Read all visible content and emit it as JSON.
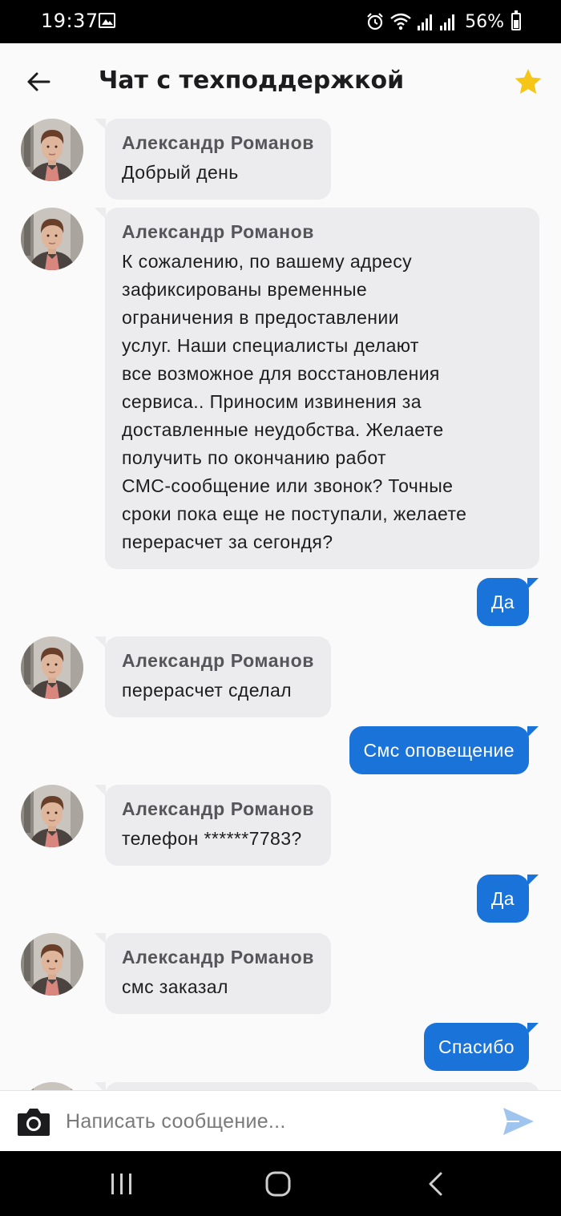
{
  "status_bar": {
    "time": "19:37",
    "battery": "56%",
    "icons": [
      "gallery-icon",
      "alarm-icon",
      "wifi-icon",
      "signal-icon",
      "signal-icon",
      "battery-icon"
    ]
  },
  "header": {
    "title": "Чат с техподдержкой",
    "back_icon": "arrow-left-icon",
    "favorite_icon": "star-icon",
    "favorite_color": "#f5c518"
  },
  "colors": {
    "incoming_bubble": "#ececef",
    "outgoing_bubble": "#1a73d9",
    "send_icon": "#9fc5ef"
  },
  "messages": [
    {
      "direction": "in",
      "sender": "Александр Романов",
      "text": "Добрый день"
    },
    {
      "direction": "in",
      "sender": "Александр Романов",
      "text": "К сожалению, по вашему адресу\nзафиксированы временные\nограничения в предоставлении\nуслуг. Наши специалисты делают\nвсе возможное для восстановления\nсервиса.. Приносим извинения за\nдоставленные неудобства. Желаете\nполучить по окончанию работ\nСМС-сообщение или звонок? Точные\nсроки пока еще не поступали, желаете\nперерасчет за сегондя?"
    },
    {
      "direction": "out",
      "text": "Да"
    },
    {
      "direction": "in",
      "sender": "Александр Романов",
      "text": "перерасчет сделал"
    },
    {
      "direction": "out",
      "text": "Смс оповещение"
    },
    {
      "direction": "in",
      "sender": "Александр Романов",
      "text": "телефон ******7783?"
    },
    {
      "direction": "out",
      "text": "Да"
    },
    {
      "direction": "in",
      "sender": "Александр Романов",
      "text": "смс заказал"
    },
    {
      "direction": "out",
      "text": "Спасибо"
    }
  ],
  "composer": {
    "placeholder": "Написать сообщение...",
    "value": "",
    "camera_icon": "camera-icon",
    "send_icon": "send-icon"
  },
  "nav_bar": {
    "icons": [
      "recents-icon",
      "home-icon",
      "back-icon"
    ]
  }
}
